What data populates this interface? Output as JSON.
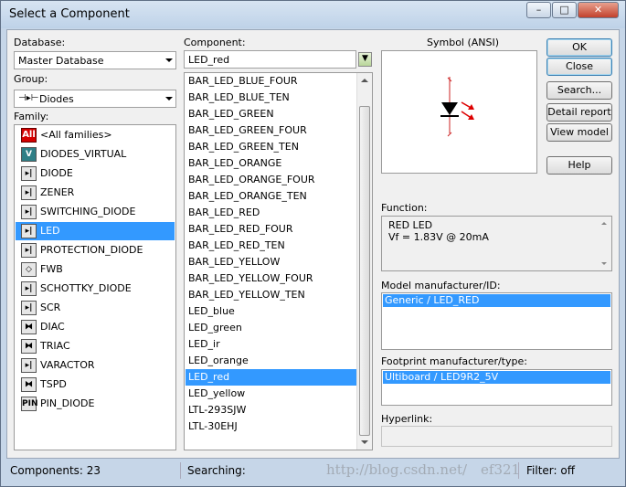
{
  "window": {
    "title": "Select a Component",
    "minimize_label": "–",
    "maximize_label": "□",
    "close_label": "✕"
  },
  "database": {
    "label": "Database:",
    "value": "Master Database"
  },
  "group": {
    "label": "Group:",
    "value": "Diodes",
    "icon": "diode-icon"
  },
  "family": {
    "label": "Family:",
    "items": [
      {
        "label": "<All families>",
        "icon": "All"
      },
      {
        "label": "DIODES_VIRTUAL",
        "icon": "V"
      },
      {
        "label": "DIODE",
        "icon": "▸|"
      },
      {
        "label": "ZENER",
        "icon": "▸|"
      },
      {
        "label": "SWITCHING_DIODE",
        "icon": "▸|"
      },
      {
        "label": "LED",
        "icon": "▸|"
      },
      {
        "label": "PROTECTION_DIODE",
        "icon": "▸|"
      },
      {
        "label": "FWB",
        "icon": "◇"
      },
      {
        "label": "SCHOTTKY_DIODE",
        "icon": "▸|"
      },
      {
        "label": "SCR",
        "icon": "▸|"
      },
      {
        "label": "DIAC",
        "icon": "⧓"
      },
      {
        "label": "TRIAC",
        "icon": "⧓"
      },
      {
        "label": "VARACTOR",
        "icon": "▸|"
      },
      {
        "label": "TSPD",
        "icon": "⧓"
      },
      {
        "label": "PIN_DIODE",
        "icon": "PIN"
      }
    ],
    "selected": "LED"
  },
  "component": {
    "label": "Component:",
    "filter_value": "LED_red",
    "items": [
      "BAR_LED_BLUE_FOUR",
      "BAR_LED_BLUE_TEN",
      "BAR_LED_GREEN",
      "BAR_LED_GREEN_FOUR",
      "BAR_LED_GREEN_TEN",
      "BAR_LED_ORANGE",
      "BAR_LED_ORANGE_FOUR",
      "BAR_LED_ORANGE_TEN",
      "BAR_LED_RED",
      "BAR_LED_RED_FOUR",
      "BAR_LED_RED_TEN",
      "BAR_LED_YELLOW",
      "BAR_LED_YELLOW_FOUR",
      "BAR_LED_YELLOW_TEN",
      "LED_blue",
      "LED_green",
      "LED_ir",
      "LED_orange",
      "LED_red",
      "LED_yellow",
      "LTL-293SJW",
      "LTL-30EHJ"
    ],
    "selected": "LED_red"
  },
  "symbol": {
    "label": "Symbol (ANSI)"
  },
  "buttons": {
    "ok": "OK",
    "close": "Close",
    "search": "Search...",
    "detail_report": "Detail report",
    "view_model": "View model",
    "help": "Help"
  },
  "function": {
    "label": "Function:",
    "line1": "RED LED",
    "line2": "Vf = 1.83V @ 20mA"
  },
  "model": {
    "label": "Model manufacturer/ID:",
    "value": "Generic / LED_RED"
  },
  "footprint": {
    "label": "Footprint manufacturer/type:",
    "value": "Ultiboard / LED9R2_5V"
  },
  "hyperlink": {
    "label": "Hyperlink:",
    "value": ""
  },
  "status": {
    "components": "Components: 23",
    "searching": "Searching:",
    "filter": "Filter: off"
  },
  "watermark": "http://blog.csdn.net/ ef321"
}
